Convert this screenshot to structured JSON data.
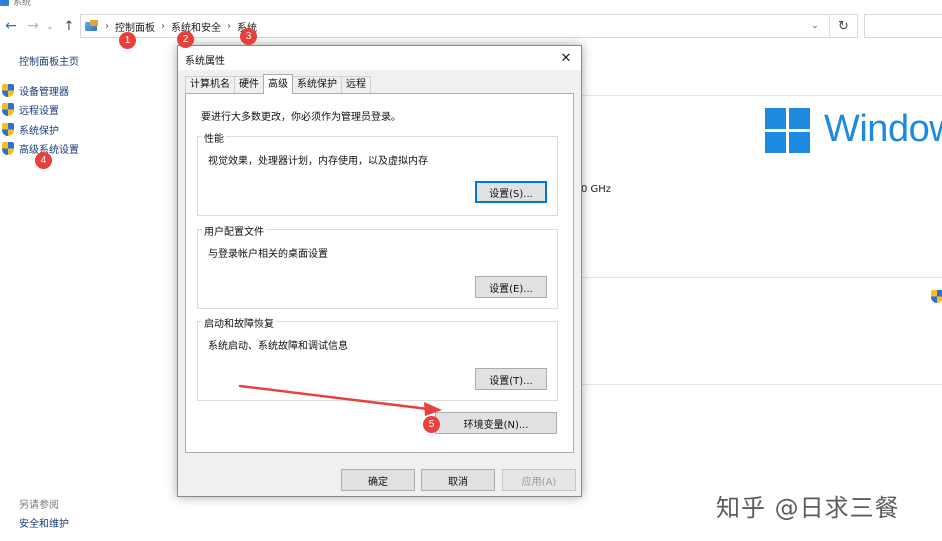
{
  "window": {
    "title": "系统"
  },
  "address_bar": {
    "breadcrumb": [
      "控制面板",
      "系统和安全",
      "系统"
    ]
  },
  "sidebar": {
    "home_label": "控制面板主页",
    "items": [
      {
        "label": "设备管理器",
        "icon": "shield-icon"
      },
      {
        "label": "远程设置",
        "icon": "shield-icon"
      },
      {
        "label": "系统保护",
        "icon": "shield-icon"
      },
      {
        "label": "高级系统设置",
        "icon": "shield-icon"
      }
    ],
    "see_also_label": "另请参阅",
    "security_label": "安全和维护"
  },
  "background": {
    "ghz_text": "0 GHz",
    "logo_text": "Windows",
    "logo_color": "#1d8ae0"
  },
  "dialog": {
    "title": "系统属性",
    "tabs": [
      "计算机名",
      "硬件",
      "高级",
      "系统保护",
      "远程"
    ],
    "active_tab": "高级",
    "admin_note": "要进行大多数更改，你必须作为管理员登录。",
    "performance": {
      "label": "性能",
      "description": "视觉效果，处理器计划，内存使用，以及虚拟内存",
      "button": "设置(S)..."
    },
    "user_profiles": {
      "label": "用户配置文件",
      "description": "与登录帐户相关的桌面设置",
      "button": "设置(E)..."
    },
    "startup_recovery": {
      "label": "启动和故障恢复",
      "description": "系统启动、系统故障和调试信息",
      "button": "设置(T)..."
    },
    "env_button": "环境变量(N)...",
    "ok_button": "确定",
    "cancel_button": "取消",
    "apply_button": "应用(A)"
  },
  "annotations": {
    "badges": [
      "1",
      "2",
      "3",
      "4",
      "5"
    ],
    "color": "#e8403a"
  },
  "watermark": "知乎 @日求三餐"
}
